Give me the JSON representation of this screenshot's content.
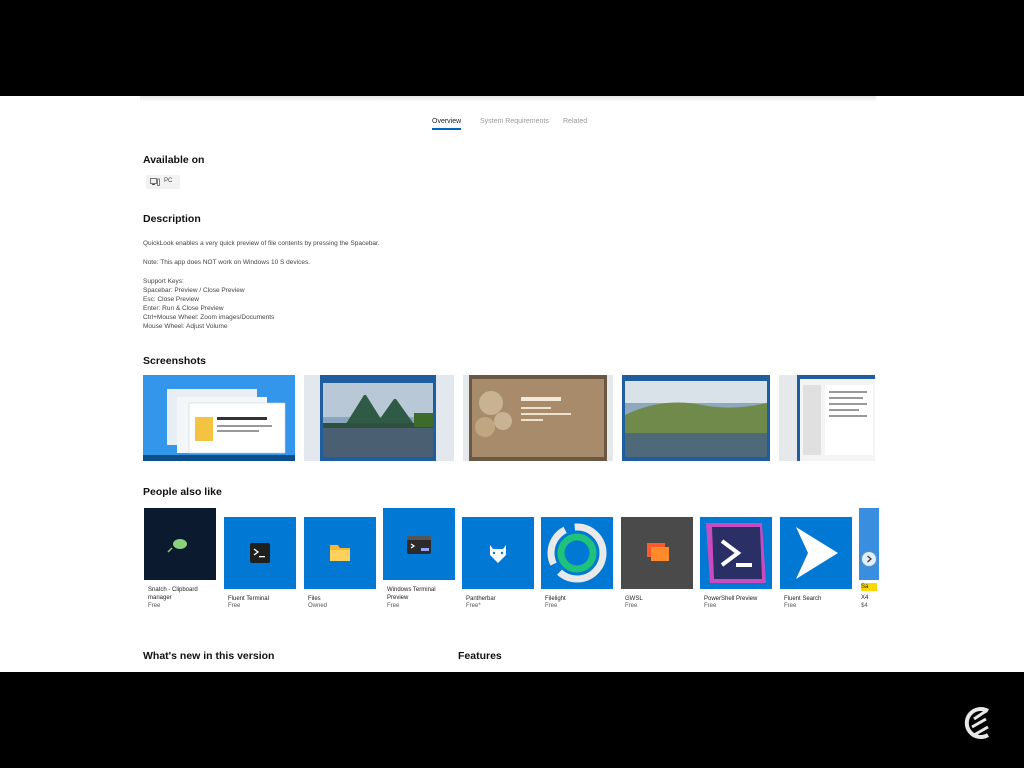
{
  "tabs": [
    {
      "label": "Overview",
      "active": true
    },
    {
      "label": "System Requirements",
      "active": false
    },
    {
      "label": "Related",
      "active": false
    }
  ],
  "available_on": {
    "title": "Available on",
    "platform_icon": "pc-icon",
    "platform_label": "PC"
  },
  "description": {
    "title": "Description",
    "lines": [
      "QuickLook enables a very quick preview of file contents by pressing the Spacebar.",
      "Note: This app does NOT work on Windows 10 S devices.",
      "Support Keys:",
      "Spacebar: Preview / Close Preview",
      "Esc: Close Preview",
      "Enter: Run & Close Preview",
      "Ctrl+Mouse Wheel: Zoom images/Documents",
      "Mouse Wheel: Adjust Volume"
    ]
  },
  "screenshots": {
    "title": "Screenshots",
    "items": [
      {
        "name": "screenshot-windows-desktop"
      },
      {
        "name": "screenshot-bridge-photo"
      },
      {
        "name": "screenshot-document-preview"
      },
      {
        "name": "screenshot-landscape-photo"
      },
      {
        "name": "screenshot-pdf-preview"
      }
    ]
  },
  "people_also_like": {
    "title": "People also like",
    "apps": [
      {
        "name": "Snatch - Clipboard manager",
        "price": "Free",
        "bg": "#0b1a2e",
        "icon": "clipboard-leaf-icon"
      },
      {
        "name": "Fluent Terminal",
        "price": "Free",
        "bg": "#0078d4",
        "icon": "terminal-icon"
      },
      {
        "name": "Files",
        "price": "Owned",
        "bg": "#0078d4",
        "icon": "folder-icon"
      },
      {
        "name": "Windows Terminal Preview",
        "price": "Free",
        "bg": "#0078d4",
        "icon": "terminal-preview-icon"
      },
      {
        "name": "Pantherbar",
        "price": "Free*",
        "bg": "#0078d4",
        "icon": "panther-icon"
      },
      {
        "name": "Filelight",
        "price": "Free",
        "bg": "#0078d4",
        "icon": "filelight-ring-icon"
      },
      {
        "name": "GWSL",
        "price": "Free",
        "bg": "#4a4a4a",
        "icon": "gwsl-windows-icon"
      },
      {
        "name": "PowerShell Preview",
        "price": "Free",
        "bg": "#0078d4",
        "icon": "powershell-icon"
      },
      {
        "name": "Fluent Search",
        "price": "Free",
        "bg": "#0078d4",
        "icon": "arrow-cursor-icon"
      },
      {
        "name": "X4",
        "price": "$4",
        "badge": "Sa",
        "bg": "#0078d4",
        "icon": "partial-tile-icon"
      }
    ]
  },
  "whats_new": {
    "title": "What's new in this version"
  },
  "features": {
    "title": "Features"
  }
}
